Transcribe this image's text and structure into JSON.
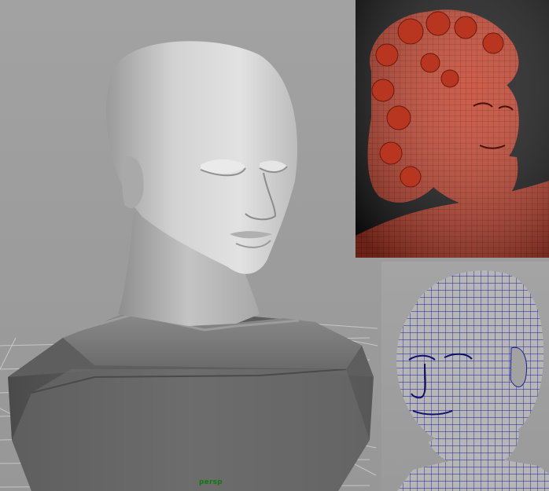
{
  "viewport": {
    "camera_label": "persp"
  },
  "colors": {
    "viewport_bg": "#9d9d9d",
    "grid_line": "#c7c7c7",
    "camera_label": "#0e7a0e",
    "sculpt_clay": "#c4402a",
    "wireframe": "#1a1a9a",
    "render_bg": "#151515"
  },
  "panels": [
    {
      "name": "main-shaded-viewport"
    },
    {
      "name": "sculpt-render-inset"
    },
    {
      "name": "wireframe-inset"
    }
  ]
}
